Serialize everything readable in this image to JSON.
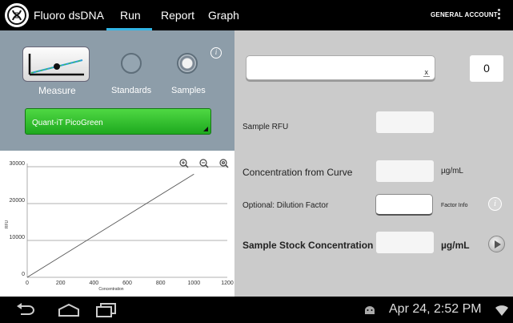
{
  "app": {
    "title": "Fluoro dsDNA",
    "account": "GENERAL ACCOUNT"
  },
  "tabs": [
    {
      "label": "Run",
      "active": true
    },
    {
      "label": "Report",
      "active": false
    },
    {
      "label": "Graph",
      "active": false
    }
  ],
  "mode": {
    "measure_label": "Measure",
    "standards_label": "Standards",
    "samples_label": "Samples",
    "selected": "Samples"
  },
  "assay": {
    "name": "Quant-iT PicoGreen"
  },
  "sample": {
    "name_value": "",
    "clear_label": "x",
    "count": "0"
  },
  "fields": {
    "rfu_label": "Sample RFU",
    "rfu_value": "",
    "conc_label": "Concentration from Curve",
    "conc_value": "",
    "conc_unit": "µg/mL",
    "dilution_label": "Optional: Dilution Factor",
    "dilution_value": "",
    "factor_info_label": "Factor Info",
    "stock_label": "Sample Stock Concentration",
    "stock_value": "",
    "stock_unit": "µg/mL"
  },
  "status": {
    "datetime": "Apr 24, 2:52 PM"
  },
  "colors": {
    "accent": "#33b5e5",
    "assay_green": "#2dbf2a",
    "panel_blue_gray": "#8d9da9",
    "panel_gray": "#cbcbcb"
  },
  "chart_data": {
    "type": "line",
    "title": "",
    "xlabel": "Concentration",
    "ylabel": "RFU",
    "xlim": [
      0,
      1200
    ],
    "ylim": [
      0,
      30000
    ],
    "x_ticks": [
      "0",
      "200",
      "400",
      "600",
      "800",
      "1000",
      "1200"
    ],
    "y_ticks": [
      "0",
      "10000",
      "20000",
      "30000"
    ],
    "grid": "horizontal",
    "series": [
      {
        "x": [
          0,
          1000
        ],
        "y": [
          0,
          28000
        ]
      }
    ]
  }
}
